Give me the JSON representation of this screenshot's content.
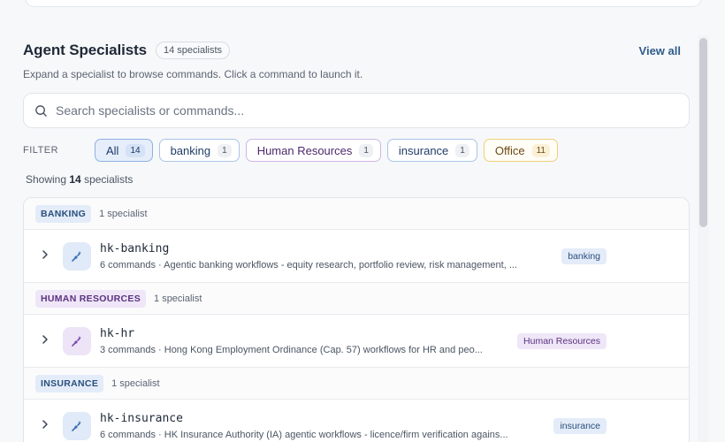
{
  "section": {
    "title": "Agent Specialists",
    "count_pill": "14 specialists",
    "view_all": "View all",
    "subtitle": "Expand a specialist to browse commands. Click a command to launch it."
  },
  "search": {
    "placeholder": "Search specialists or commands..."
  },
  "filter": {
    "label": "FILTER",
    "chips": [
      {
        "label": "All",
        "count": "14"
      },
      {
        "label": "banking",
        "count": "1"
      },
      {
        "label": "Human Resources",
        "count": "1"
      },
      {
        "label": "insurance",
        "count": "1"
      },
      {
        "label": "Office",
        "count": "11"
      }
    ]
  },
  "showing": {
    "prefix": "Showing",
    "count": "14",
    "suffix": "specialists"
  },
  "groups": [
    {
      "tag": "BANKING",
      "count": "1 specialist",
      "item": {
        "name": "hk-banking",
        "desc": "6 commands · Agentic banking workflows - equity research, portfolio review, risk management, ...",
        "badge": "banking"
      }
    },
    {
      "tag": "HUMAN RESOURCES",
      "count": "1 specialist",
      "item": {
        "name": "hk-hr",
        "desc": "3 commands · Hong Kong Employment Ordinance (Cap. 57) workflows for HR and peo...",
        "badge": "Human Resources"
      }
    },
    {
      "tag": "INSURANCE",
      "count": "1 specialist",
      "item": {
        "name": "hk-insurance",
        "desc": "6 commands · HK Insurance Authority (IA) agentic workflows - licence/firm verification agains...",
        "badge": "insurance"
      }
    }
  ],
  "colors": {
    "accent": "#2f5d8a",
    "banking": "#2a4f7e",
    "hr": "#5a3380",
    "office": "#6b4a14"
  }
}
